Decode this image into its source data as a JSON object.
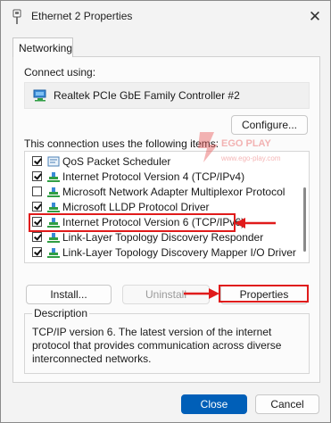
{
  "window": {
    "title": "Ethernet 2 Properties",
    "close_glyph": "✕"
  },
  "tabs": [
    {
      "label": "Networking"
    }
  ],
  "connect_using": {
    "label": "Connect using:",
    "adapter_name": "Realtek PCIe GbE Family Controller #2",
    "adapter_icon": "network-adapter-icon"
  },
  "buttons": {
    "configure": "Configure...",
    "install": "Install...",
    "uninstall": "Uninstall",
    "properties": "Properties",
    "close": "Close",
    "cancel": "Cancel"
  },
  "items_label": "This connection uses the following items:",
  "items": [
    {
      "label": "QoS Packet Scheduler",
      "checked": true,
      "icon": "scheduler-icon"
    },
    {
      "label": "Internet Protocol Version 4 (TCP/IPv4)",
      "checked": true,
      "icon": "protocol-icon"
    },
    {
      "label": "Microsoft Network Adapter Multiplexor Protocol",
      "checked": false,
      "icon": "protocol-icon"
    },
    {
      "label": "Microsoft LLDP Protocol Driver",
      "checked": true,
      "icon": "protocol-icon"
    },
    {
      "label": "Internet Protocol Version 6 (TCP/IPv6)",
      "checked": true,
      "icon": "protocol-icon",
      "selected": true
    },
    {
      "label": "Link-Layer Topology Discovery Responder",
      "checked": true,
      "icon": "protocol-icon"
    },
    {
      "label": "Link-Layer Topology Discovery Mapper I/O Driver",
      "checked": true,
      "icon": "protocol-icon"
    }
  ],
  "description": {
    "legend": "Description",
    "text": "TCP/IP version 6. The latest version of the internet protocol that provides communication across diverse interconnected networks."
  },
  "watermark": {
    "brand": "EGO PLAY",
    "url": "www.ego-play.com"
  },
  "colors": {
    "annotation": "#e01b1b",
    "primary_button": "#005fb8"
  }
}
